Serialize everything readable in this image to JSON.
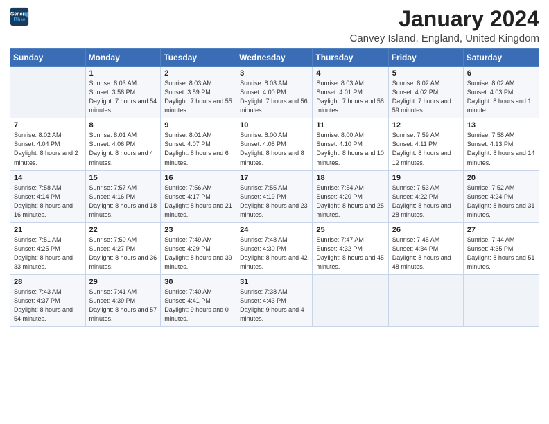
{
  "logo": {
    "line1": "General",
    "line2": "Blue"
  },
  "header": {
    "month": "January 2024",
    "location": "Canvey Island, England, United Kingdom"
  },
  "weekdays": [
    "Sunday",
    "Monday",
    "Tuesday",
    "Wednesday",
    "Thursday",
    "Friday",
    "Saturday"
  ],
  "weeks": [
    [
      {
        "day": "",
        "sunrise": "",
        "sunset": "",
        "daylight": ""
      },
      {
        "day": "1",
        "sunrise": "Sunrise: 8:03 AM",
        "sunset": "Sunset: 3:58 PM",
        "daylight": "Daylight: 7 hours and 54 minutes."
      },
      {
        "day": "2",
        "sunrise": "Sunrise: 8:03 AM",
        "sunset": "Sunset: 3:59 PM",
        "daylight": "Daylight: 7 hours and 55 minutes."
      },
      {
        "day": "3",
        "sunrise": "Sunrise: 8:03 AM",
        "sunset": "Sunset: 4:00 PM",
        "daylight": "Daylight: 7 hours and 56 minutes."
      },
      {
        "day": "4",
        "sunrise": "Sunrise: 8:03 AM",
        "sunset": "Sunset: 4:01 PM",
        "daylight": "Daylight: 7 hours and 58 minutes."
      },
      {
        "day": "5",
        "sunrise": "Sunrise: 8:02 AM",
        "sunset": "Sunset: 4:02 PM",
        "daylight": "Daylight: 7 hours and 59 minutes."
      },
      {
        "day": "6",
        "sunrise": "Sunrise: 8:02 AM",
        "sunset": "Sunset: 4:03 PM",
        "daylight": "Daylight: 8 hours and 1 minute."
      }
    ],
    [
      {
        "day": "7",
        "sunrise": "Sunrise: 8:02 AM",
        "sunset": "Sunset: 4:04 PM",
        "daylight": "Daylight: 8 hours and 2 minutes."
      },
      {
        "day": "8",
        "sunrise": "Sunrise: 8:01 AM",
        "sunset": "Sunset: 4:06 PM",
        "daylight": "Daylight: 8 hours and 4 minutes."
      },
      {
        "day": "9",
        "sunrise": "Sunrise: 8:01 AM",
        "sunset": "Sunset: 4:07 PM",
        "daylight": "Daylight: 8 hours and 6 minutes."
      },
      {
        "day": "10",
        "sunrise": "Sunrise: 8:00 AM",
        "sunset": "Sunset: 4:08 PM",
        "daylight": "Daylight: 8 hours and 8 minutes."
      },
      {
        "day": "11",
        "sunrise": "Sunrise: 8:00 AM",
        "sunset": "Sunset: 4:10 PM",
        "daylight": "Daylight: 8 hours and 10 minutes."
      },
      {
        "day": "12",
        "sunrise": "Sunrise: 7:59 AM",
        "sunset": "Sunset: 4:11 PM",
        "daylight": "Daylight: 8 hours and 12 minutes."
      },
      {
        "day": "13",
        "sunrise": "Sunrise: 7:58 AM",
        "sunset": "Sunset: 4:13 PM",
        "daylight": "Daylight: 8 hours and 14 minutes."
      }
    ],
    [
      {
        "day": "14",
        "sunrise": "Sunrise: 7:58 AM",
        "sunset": "Sunset: 4:14 PM",
        "daylight": "Daylight: 8 hours and 16 minutes."
      },
      {
        "day": "15",
        "sunrise": "Sunrise: 7:57 AM",
        "sunset": "Sunset: 4:16 PM",
        "daylight": "Daylight: 8 hours and 18 minutes."
      },
      {
        "day": "16",
        "sunrise": "Sunrise: 7:56 AM",
        "sunset": "Sunset: 4:17 PM",
        "daylight": "Daylight: 8 hours and 21 minutes."
      },
      {
        "day": "17",
        "sunrise": "Sunrise: 7:55 AM",
        "sunset": "Sunset: 4:19 PM",
        "daylight": "Daylight: 8 hours and 23 minutes."
      },
      {
        "day": "18",
        "sunrise": "Sunrise: 7:54 AM",
        "sunset": "Sunset: 4:20 PM",
        "daylight": "Daylight: 8 hours and 25 minutes."
      },
      {
        "day": "19",
        "sunrise": "Sunrise: 7:53 AM",
        "sunset": "Sunset: 4:22 PM",
        "daylight": "Daylight: 8 hours and 28 minutes."
      },
      {
        "day": "20",
        "sunrise": "Sunrise: 7:52 AM",
        "sunset": "Sunset: 4:24 PM",
        "daylight": "Daylight: 8 hours and 31 minutes."
      }
    ],
    [
      {
        "day": "21",
        "sunrise": "Sunrise: 7:51 AM",
        "sunset": "Sunset: 4:25 PM",
        "daylight": "Daylight: 8 hours and 33 minutes."
      },
      {
        "day": "22",
        "sunrise": "Sunrise: 7:50 AM",
        "sunset": "Sunset: 4:27 PM",
        "daylight": "Daylight: 8 hours and 36 minutes."
      },
      {
        "day": "23",
        "sunrise": "Sunrise: 7:49 AM",
        "sunset": "Sunset: 4:29 PM",
        "daylight": "Daylight: 8 hours and 39 minutes."
      },
      {
        "day": "24",
        "sunrise": "Sunrise: 7:48 AM",
        "sunset": "Sunset: 4:30 PM",
        "daylight": "Daylight: 8 hours and 42 minutes."
      },
      {
        "day": "25",
        "sunrise": "Sunrise: 7:47 AM",
        "sunset": "Sunset: 4:32 PM",
        "daylight": "Daylight: 8 hours and 45 minutes."
      },
      {
        "day": "26",
        "sunrise": "Sunrise: 7:45 AM",
        "sunset": "Sunset: 4:34 PM",
        "daylight": "Daylight: 8 hours and 48 minutes."
      },
      {
        "day": "27",
        "sunrise": "Sunrise: 7:44 AM",
        "sunset": "Sunset: 4:35 PM",
        "daylight": "Daylight: 8 hours and 51 minutes."
      }
    ],
    [
      {
        "day": "28",
        "sunrise": "Sunrise: 7:43 AM",
        "sunset": "Sunset: 4:37 PM",
        "daylight": "Daylight: 8 hours and 54 minutes."
      },
      {
        "day": "29",
        "sunrise": "Sunrise: 7:41 AM",
        "sunset": "Sunset: 4:39 PM",
        "daylight": "Daylight: 8 hours and 57 minutes."
      },
      {
        "day": "30",
        "sunrise": "Sunrise: 7:40 AM",
        "sunset": "Sunset: 4:41 PM",
        "daylight": "Daylight: 9 hours and 0 minutes."
      },
      {
        "day": "31",
        "sunrise": "Sunrise: 7:38 AM",
        "sunset": "Sunset: 4:43 PM",
        "daylight": "Daylight: 9 hours and 4 minutes."
      },
      {
        "day": "",
        "sunrise": "",
        "sunset": "",
        "daylight": ""
      },
      {
        "day": "",
        "sunrise": "",
        "sunset": "",
        "daylight": ""
      },
      {
        "day": "",
        "sunrise": "",
        "sunset": "",
        "daylight": ""
      }
    ]
  ]
}
